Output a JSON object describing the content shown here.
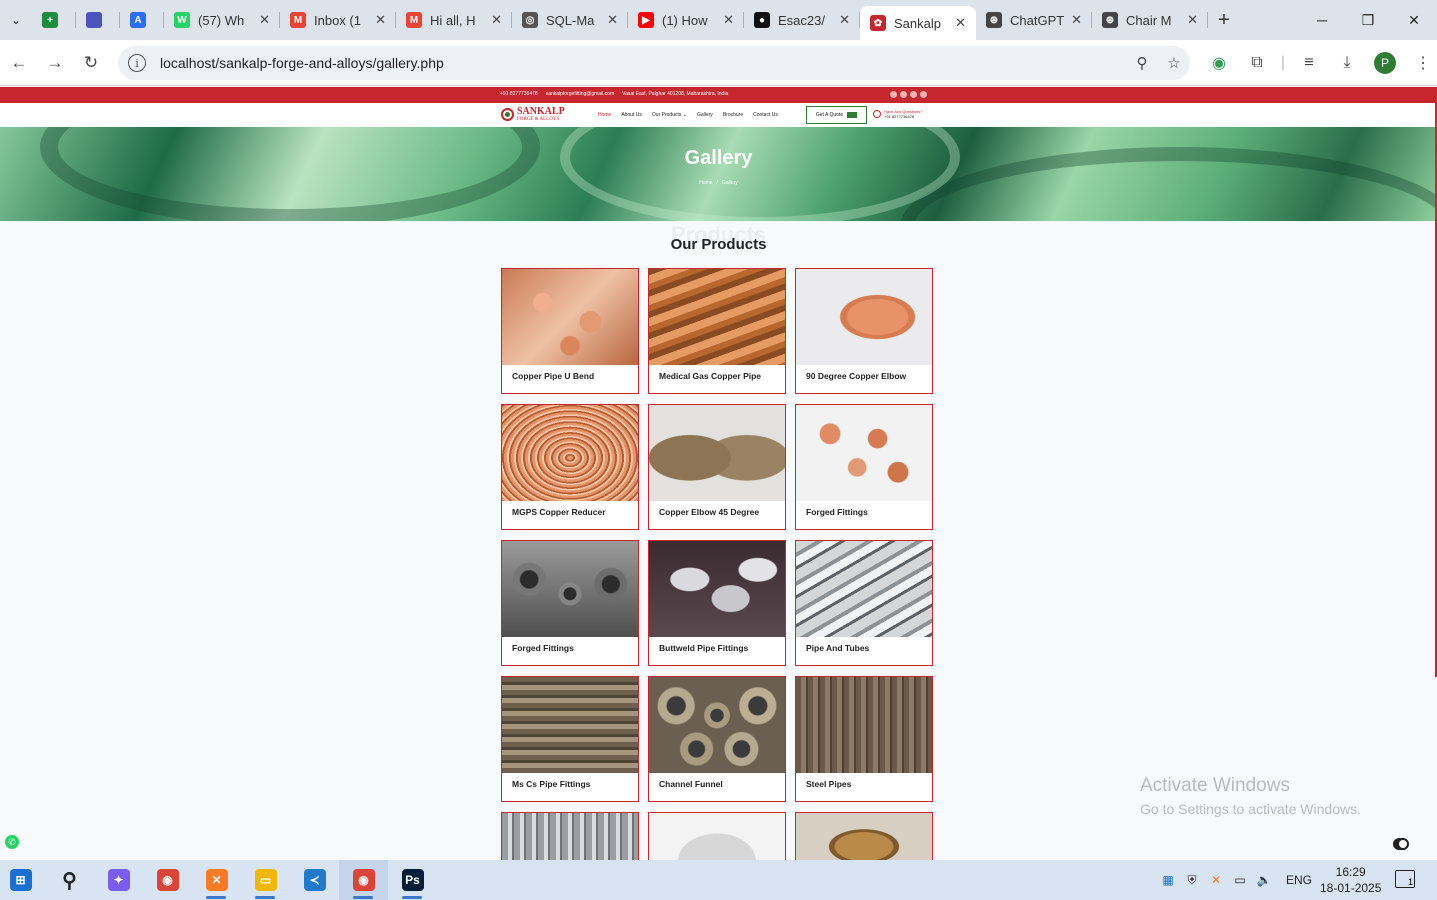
{
  "browser": {
    "tabs": [
      {
        "title": "",
        "color": "#1e8e3e",
        "glyph": "+",
        "active": false,
        "icon_only": true,
        "icon": "sheets-icon"
      },
      {
        "title": "",
        "color": "#4b53bc",
        "glyph": "",
        "active": false,
        "icon_only": true,
        "icon": "shield-icon"
      },
      {
        "title": "",
        "color": "#2b6ef5",
        "glyph": "A",
        "active": false,
        "icon_only": true,
        "icon": "translate-icon"
      },
      {
        "title": "(57) Wh",
        "color": "#25d366",
        "glyph": "W",
        "active": false,
        "icon": "whatsapp-icon"
      },
      {
        "title": "Inbox (1",
        "color": "#ea4335",
        "glyph": "M",
        "active": false,
        "icon": "gmail-icon"
      },
      {
        "title": "Hi all, H",
        "color": "#ea4335",
        "glyph": "M",
        "active": false,
        "icon": "gmail-icon"
      },
      {
        "title": "SQL-Ma",
        "color": "#555555",
        "glyph": "◎",
        "active": false,
        "icon": "globe-icon"
      },
      {
        "title": "(1) How",
        "color": "#ff0000",
        "glyph": "▶",
        "active": false,
        "icon": "youtube-icon"
      },
      {
        "title": "Esac23/",
        "color": "#111111",
        "glyph": "●",
        "active": false,
        "icon": "github-icon"
      },
      {
        "title": "Sankalp",
        "color": "#c6262e",
        "glyph": "✿",
        "active": true,
        "icon": "sankalp-icon"
      },
      {
        "title": "ChatGPT",
        "color": "#444444",
        "glyph": "⊛",
        "active": false,
        "icon": "chatgpt-icon"
      },
      {
        "title": "Chair M",
        "color": "#444444",
        "glyph": "⊛",
        "active": false,
        "icon": "chatgpt-icon"
      }
    ],
    "url": "localhost/sankalp-forge-and-alloys/gallery.php",
    "profile_initial": "P"
  },
  "site": {
    "topbar": {
      "phone": "+91 8277736478",
      "email": "sankalpforgefitting@gmail.com",
      "address": "Vasai East, Palghar 401208, Maharashtra, India"
    },
    "logo": {
      "name": "SANKALP",
      "tagline": "FORGE & ALLOYS"
    },
    "menu": [
      "Home",
      "About Us",
      "Our Products ⌄",
      "Gallery",
      "Brochure",
      "Contact Us"
    ],
    "quote_button": "Get A Quote",
    "call": {
      "question": "Have Any Questions?",
      "phone": "+91 8277736478"
    },
    "hero": {
      "title": "Gallery",
      "crumb_home": "Home",
      "crumb_sep": "/",
      "crumb_current": "Gallery"
    },
    "section_ghost": "Products",
    "section_title": "Our Products",
    "products": [
      {
        "name": "Copper Pipe U Bend",
        "look": "copper"
      },
      {
        "name": "Medical Gas Copper Pipe",
        "look": "pipes"
      },
      {
        "name": "90 Degree Copper Elbow",
        "look": "elbow"
      },
      {
        "name": "MGPS Copper Reducer",
        "look": "coil"
      },
      {
        "name": "Copper Elbow 45 Degree",
        "look": "elbow45"
      },
      {
        "name": "Forged Fittings",
        "look": "forged1"
      },
      {
        "name": "Forged Fittings",
        "look": "forged2"
      },
      {
        "name": "Buttweld Pipe Fittings",
        "look": "buttweld"
      },
      {
        "name": "Pipe And Tubes",
        "look": "tubes"
      },
      {
        "name": "Ms Cs Pipe Fittings",
        "look": "mscs"
      },
      {
        "name": "Channel Funnel",
        "look": "funnel"
      },
      {
        "name": "Steel Pipes",
        "look": "steel"
      }
    ],
    "partial_products": [
      {
        "look": "rods"
      },
      {
        "look": "bend"
      },
      {
        "look": "flange"
      }
    ]
  },
  "watermark": {
    "line1": "Activate Windows",
    "line2": "Go to Settings to activate Windows."
  },
  "taskbar": {
    "apps": [
      {
        "name": "start-icon",
        "color": "#1a6fd1",
        "glyph": "⊞",
        "running": false
      },
      {
        "name": "search-icon",
        "color": "#d9e4f2",
        "glyph": "⚲",
        "running": false
      },
      {
        "name": "copilot-icon",
        "color": "#7b5cf0",
        "glyph": "✦",
        "running": false
      },
      {
        "name": "chrome-icon",
        "color": "#db4437",
        "glyph": "◉",
        "running": false
      },
      {
        "name": "xampp-icon",
        "color": "#fb7a24",
        "glyph": "✕",
        "running": true
      },
      {
        "name": "file-explorer-icon",
        "color": "#f2b705",
        "glyph": "▭",
        "running": true
      },
      {
        "name": "vscode-icon",
        "color": "#1f7acc",
        "glyph": "≺",
        "running": false
      },
      {
        "name": "chrome-icon",
        "color": "#db4437",
        "glyph": "◉",
        "running": true,
        "focused": true
      },
      {
        "name": "photoshop-icon",
        "color": "#001e36",
        "glyph": "Ps",
        "running": true
      }
    ],
    "lang": "ENG",
    "time": "16:29",
    "date": "18-01-2025",
    "notifications": "1"
  }
}
